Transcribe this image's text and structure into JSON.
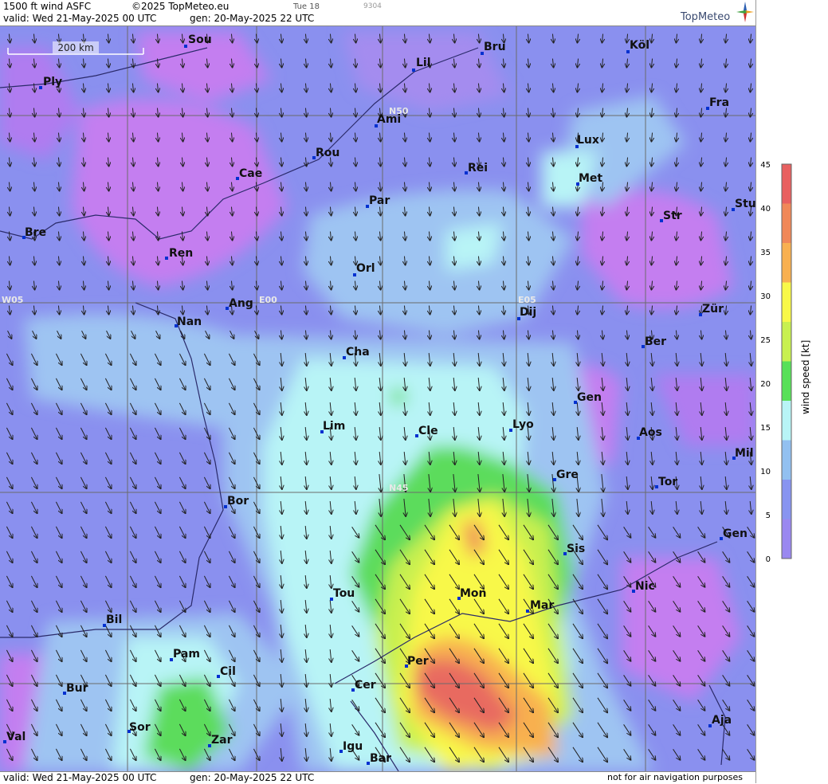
{
  "header": {
    "product": "1500 ft wind ASFC",
    "copyright": "©2025 TopMeteo.eu",
    "run_label": "Tue 18",
    "code": "9304",
    "valid": "valid:  Wed  21-May-2025  00 UTC",
    "gen": "gen: 20-May-2025 22 UTC",
    "logo": "TopMeteo"
  },
  "footer": {
    "valid": "valid:  Wed  21-May-2025  00 UTC",
    "gen": "gen: 20-May-2025 22 UTC",
    "disclaimer": "not for air navigation purposes"
  },
  "scale_bar": "200 km",
  "grid_labels": [
    "N50",
    "N45",
    "W05",
    "E00",
    "E05"
  ],
  "cities": [
    "Sou",
    "Ply",
    "Bru",
    "Köl",
    "Lil",
    "Ami",
    "Fra",
    "Lux",
    "Rou",
    "Cae",
    "Rei",
    "Met",
    "Par",
    "Bre",
    "Ren",
    "Str",
    "Stu",
    "Orl",
    "Ang",
    "Nan",
    "Dij",
    "Zür",
    "Ber",
    "Cha",
    "Gen",
    "Lim",
    "Cle",
    "Lyo",
    "Aos",
    "Mil",
    "Gre",
    "Tor",
    "Bor",
    "Sis",
    "Gen",
    "Nic",
    "Tou",
    "Mon",
    "Mar",
    "Bil",
    "Pam",
    "Cil",
    "Per",
    "Bur",
    "Cer",
    "Sor",
    "Aja",
    "Val",
    "Zar",
    "Igu",
    "Bar"
  ],
  "colorbar": {
    "title": "wind  speed  [kt]",
    "ticks": [
      "0",
      "5",
      "10",
      "15",
      "20",
      "25",
      "30",
      "35",
      "40",
      "45"
    ],
    "colors": [
      "#c880f0",
      "#9a88f0",
      "#8894f0",
      "#92c0f0",
      "#b8f4f6",
      "#58e058",
      "#c8f050",
      "#f8f848",
      "#f8b050",
      "#f08858",
      "#e86060"
    ]
  },
  "wind_direction": "north to south-southeast (arrows)"
}
